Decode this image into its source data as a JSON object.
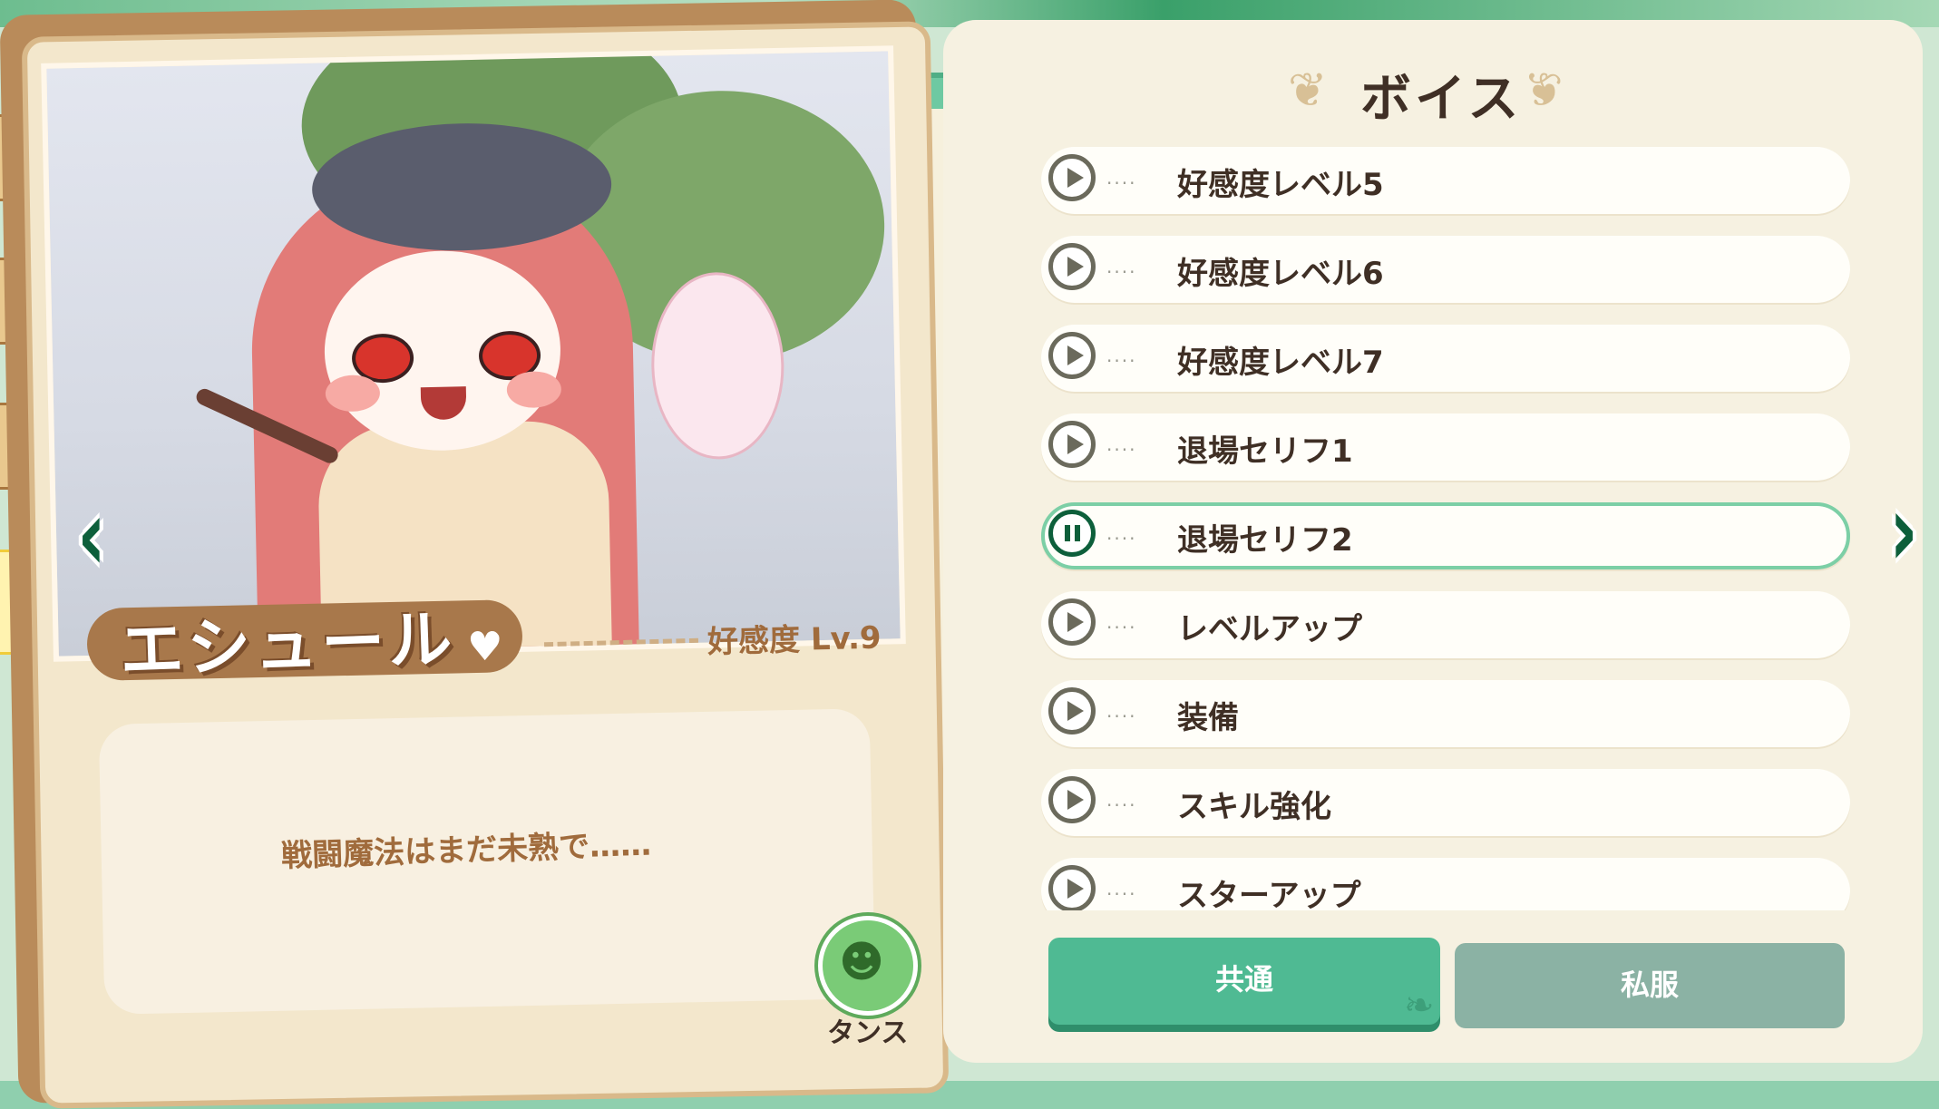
{
  "character": {
    "name": "エシュール",
    "affinity_label": "好感度 Lv.9",
    "quote": "戦闘魔法はまだ未熟で……"
  },
  "dance_button": {
    "label": "タンス",
    "icon": "frog-face-icon"
  },
  "voice_panel": {
    "title": "ボイス",
    "items": [
      {
        "label": "好感度レベル5",
        "state": "play"
      },
      {
        "label": "好感度レベル6",
        "state": "play"
      },
      {
        "label": "好感度レベル7",
        "state": "play"
      },
      {
        "label": "退場セリフ1",
        "state": "play"
      },
      {
        "label": "退場セリフ2",
        "state": "pause"
      },
      {
        "label": "レベルアップ",
        "state": "play"
      },
      {
        "label": "装備",
        "state": "play"
      },
      {
        "label": "スキル強化",
        "state": "play"
      },
      {
        "label": "スターアップ",
        "state": "play"
      }
    ],
    "active_index": 4
  },
  "tabs": {
    "common": "共通",
    "casual": "私服",
    "selected": "common"
  },
  "colors": {
    "accent_green": "#4fba93",
    "dark_green": "#0d5f3b",
    "brown_text": "#a06b3c",
    "panel_bg": "#f6f1e1"
  }
}
